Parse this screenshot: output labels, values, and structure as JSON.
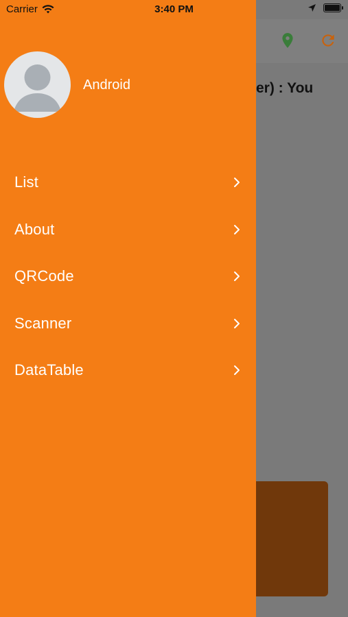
{
  "status_bar": {
    "carrier": "Carrier",
    "time": "3:40 PM"
  },
  "background": {
    "text_fragment": "er) : You",
    "icons": [
      "location-pin-icon",
      "refresh-icon"
    ],
    "pin_color": "#3a7d3a",
    "refresh_color": "#c8620d"
  },
  "drawer": {
    "background_color": "#f47d15",
    "user_name": "Android",
    "items": [
      {
        "label": "List"
      },
      {
        "label": "About"
      },
      {
        "label": "QRCode"
      },
      {
        "label": "Scanner"
      },
      {
        "label": "DataTable"
      }
    ]
  }
}
